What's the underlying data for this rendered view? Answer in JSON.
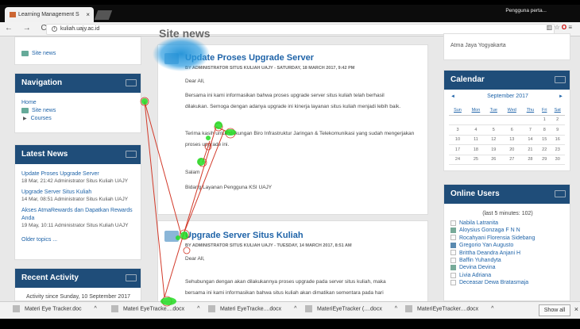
{
  "browser": {
    "tab_title": "Learning Management S",
    "tab_close": "×",
    "profile_name": "Pengguna perta...",
    "url": "kuliah.uajy.ac.id",
    "nav_glyphs": "← → C",
    "info_glyph": "i",
    "toolbar_glyphs": "▥ ☆",
    "opera_glyph": "O",
    "menu_glyph": "≡"
  },
  "left": {
    "top_block_link": "Site news",
    "navigation": {
      "title": "Navigation",
      "items": [
        "Home",
        "Site news",
        "Courses"
      ]
    },
    "latest_news": {
      "title": "Latest News",
      "items": [
        {
          "title": "Update Proses Upgrade Server",
          "meta": "18 Mar, 21:42  Administrator Situs Kuliah UAJY"
        },
        {
          "title": "Upgrade Server Situs Kuliah",
          "meta": "14 Mar, 08:51  Administrator Situs Kuliah UAJY"
        },
        {
          "title": "Akses AtmaRewards dan Dapatkan Rewards Anda",
          "meta": "19 May, 10:11  Administrator Situs Kuliah UAJY"
        }
      ],
      "older": "Older topics ..."
    },
    "recent_activity": {
      "title": "Recent Activity",
      "since": "Activity since Sunday, 10 September 2017"
    }
  },
  "center": {
    "heading": "Site news",
    "post1": {
      "title": "Update Proses Upgrade Server",
      "by": "BY ADMINISTRATOR SITUS KULIAH UAJY - SATURDAY, 18 MARCH 2017, 9:42 PM",
      "lines": [
        "Dear All,",
        "Bersama ini kami informasikan bahwa proses upgrade server situs kuliah telah berhasil",
        "dilakukan. Semoga dengan adanya upgrade ini kinerja layanan situs kuliah menjadi lebih baik.",
        "Terima kasih untuk dukungan Biro Infrastruktur Jaringan & Telekomunikasi yang sudah mengerjakan",
        "proses upgrade ini.",
        "Salam",
        "Bidang Layanan Pengguna KSI UAJY"
      ]
    },
    "post2": {
      "title": "Upgrade Server Situs Kuliah",
      "by": "BY ADMINISTRATOR SITUS KULIAH UAJY - TUESDAY, 14 MARCH 2017, 8:51 AM",
      "lines": [
        "Dear All,",
        "Sehubungan dengan akan dilakukannya proses upgrade pada server situs kuliah, maka",
        "bersama ini kami informasikan bahwa situs kuliah akan dimatikan sementara pada hari"
      ]
    }
  },
  "right": {
    "top_text": "Atma Jaya Yogyakarta",
    "calendar": {
      "title": "Calendar",
      "month": "September 2017",
      "prev": "◄",
      "next": "►",
      "days": [
        "Sun",
        "Mon",
        "Tue",
        "Wed",
        "Thu",
        "Fri",
        "Sat"
      ],
      "weeks": [
        [
          "",
          "",
          "",
          "",
          "",
          "1",
          "2"
        ],
        [
          "3",
          "4",
          "5",
          "6",
          "7",
          "8",
          "9"
        ],
        [
          "10",
          "11",
          "12",
          "13",
          "14",
          "15",
          "16"
        ],
        [
          "17",
          "18",
          "19",
          "20",
          "21",
          "22",
          "23"
        ],
        [
          "24",
          "25",
          "26",
          "27",
          "28",
          "29",
          "30"
        ]
      ]
    },
    "online": {
      "title": "Online Users",
      "subtitle": "(last 5 minutes: 102)",
      "users": [
        {
          "name": "Nabila Latranita",
          "icon": "blank"
        },
        {
          "name": "Aloysius Gonzaga F N N",
          "icon": "photo"
        },
        {
          "name": "Rocahyani Florensia Sidebang",
          "icon": "blank"
        },
        {
          "name": "Gregorio Yan Augusto",
          "icon": "photo-blue"
        },
        {
          "name": "Brittha Deandra Anjani H",
          "icon": "blank"
        },
        {
          "name": "Baffin Yuhandyta",
          "icon": "blank"
        },
        {
          "name": "Devina Devina",
          "icon": "photo"
        },
        {
          "name": "Livia Adriana",
          "icon": "blank"
        },
        {
          "name": "Deceasar Dewa Bratasmaja",
          "icon": "blank"
        }
      ]
    }
  },
  "downloads": {
    "items": [
      "Materi Eye Tracker.doc",
      "Materi EyeTracke....docx",
      "Materi EyeTracke....docx",
      "MateriEyeTracker (....docx",
      "MateriEyeTracker....docx"
    ],
    "chevron": "^",
    "show_all": "Show all",
    "close": "×"
  },
  "colors": {
    "header": "#1f4d79",
    "link": "#1e63a8",
    "gaze": "#22dd22",
    "scanpath": "#d23a2a",
    "heat": "#1e90d6"
  }
}
